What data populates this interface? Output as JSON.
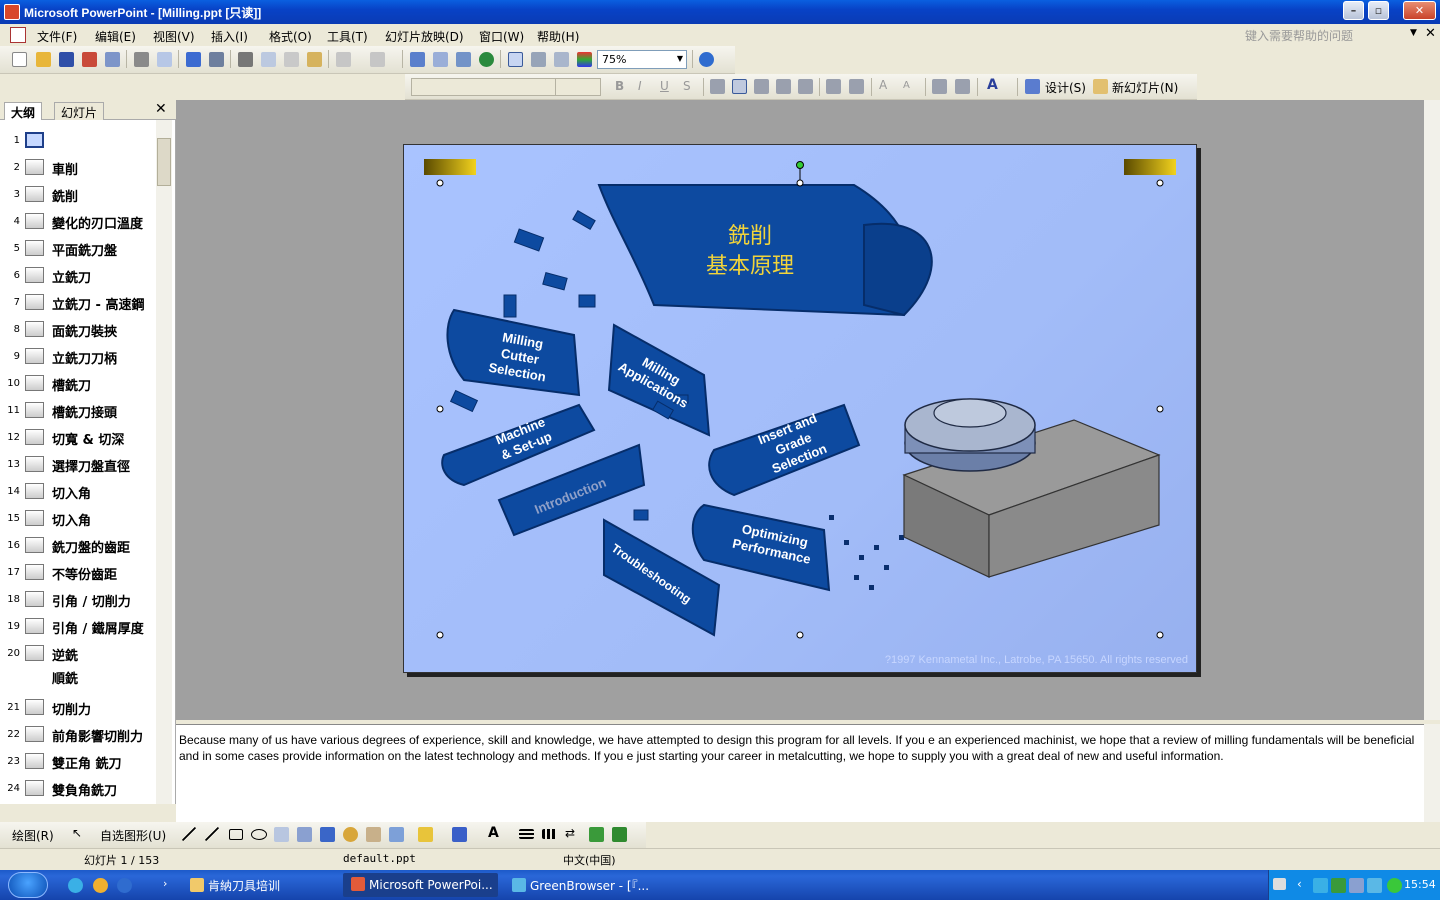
{
  "window": {
    "title": "Microsoft PowerPoint - [Milling.ppt [只读]]"
  },
  "menu": {
    "items": [
      "文件(F)",
      "编辑(E)",
      "视图(V)",
      "插入(I)",
      "格式(O)",
      "工具(T)",
      "幻灯片放映(D)",
      "窗口(W)",
      "帮助(H)"
    ],
    "help_placeholder": "键入需要帮助的问题"
  },
  "toolbar": {
    "zoom": "75%",
    "design_label": "设计(S)",
    "new_slide_label": "新幻灯片(N)"
  },
  "panel": {
    "tabs": [
      "大纲",
      "幻灯片"
    ],
    "outline": [
      {
        "num": "1",
        "title": ""
      },
      {
        "num": "2",
        "title": "車削"
      },
      {
        "num": "3",
        "title": "銑削"
      },
      {
        "num": "4",
        "title": "變化的刃口溫度"
      },
      {
        "num": "5",
        "title": "平面銑刀盤"
      },
      {
        "num": "6",
        "title": "立銑刀"
      },
      {
        "num": "7",
        "title": "立銑刀 - 高速鋼"
      },
      {
        "num": "8",
        "title": "面銑刀裝挾"
      },
      {
        "num": "9",
        "title": "立銑刀刀柄"
      },
      {
        "num": "10",
        "title": "槽銑刀"
      },
      {
        "num": "11",
        "title": "槽銑刀接頭"
      },
      {
        "num": "12",
        "title": "切寬 & 切深"
      },
      {
        "num": "13",
        "title": "選擇刀盤直徑"
      },
      {
        "num": "14",
        "title": "切入角"
      },
      {
        "num": "15",
        "title": "切入角"
      },
      {
        "num": "16",
        "title": "銑刀盤的齒距"
      },
      {
        "num": "17",
        "title": "不等份齒距"
      },
      {
        "num": "18",
        "title": "引角 / 切削力"
      },
      {
        "num": "19",
        "title": "引角 / 鐵屑厚度"
      },
      {
        "num": "20",
        "title": "逆銑"
      },
      {
        "num": "21",
        "title": "切削力"
      },
      {
        "num": "22",
        "title": "前角影響切削力"
      },
      {
        "num": "23",
        "title": "雙正角 銑刀"
      },
      {
        "num": "24",
        "title": "雙負角銑刀"
      }
    ],
    "outline_sub_20": "順銑"
  },
  "slide": {
    "title_line1": "銑削",
    "title_line2": "基本原理",
    "topics": {
      "milling_cutter_selection": [
        "Milling",
        "Cutter",
        "Selection"
      ],
      "milling_applications": [
        "Milling",
        "Applications"
      ],
      "machine_setup": [
        "Machine",
        "& Set-up"
      ],
      "introduction": "Introduction",
      "insert_grade_selection": [
        "Insert and",
        "Grade",
        "Selection"
      ],
      "optimizing_performance": [
        "Optimizing",
        "Performance"
      ],
      "troubleshooting": "Troubleshooting"
    },
    "copyright": "?1997 Kennametal Inc., Latrobe, PA 15650. All rights reserved"
  },
  "notes": {
    "text": "Because many of us have various degrees of experience, skill and knowledge, we have attempted to design this program for all levels. If you    e an experienced machinist, we hope that a review of milling fundamentals will be beneficial and in some cases provide information on the latest technology and methods. If you    e just starting your career in metalcutting, we hope to supply you with a great deal of new and useful information."
  },
  "drawbar": {
    "draw_label": "绘图(R)",
    "autoshapes_label": "自选图形(U)"
  },
  "status": {
    "slide_counter": "幻灯片 1 / 153",
    "template": "default.ppt",
    "language": "中文(中国)"
  },
  "taskbar": {
    "tasks": [
      "肯納刀具培训",
      "Microsoft PowerPoi...",
      "GreenBrowser - [『..."
    ],
    "clock": "15:54"
  },
  "colors": {
    "title_bar": "#0842c6",
    "slide_bg": "#a2bcf8",
    "banner_blue": "#0d4aa0",
    "title_text": "#f2d43a"
  }
}
